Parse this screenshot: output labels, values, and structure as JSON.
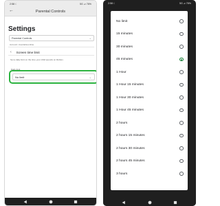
{
  "left": {
    "status": {
      "time": "2:58 ☾",
      "right": "5G ⊿ 76%"
    },
    "app_bar": {
      "title": "Parental Controls"
    },
    "settings_heading": "Settings",
    "select_value": "Parental Controls",
    "account": "Account: insertatisoonline",
    "subpage_title": "Screen time limit",
    "description": "Set a daily limit on the time your child spends on Roblox.",
    "field_label": "Daily limit",
    "field_value": "No limit"
  },
  "right": {
    "status": {
      "time": "2:58 ☾",
      "right": "5G ⊿ 76%"
    },
    "options": [
      "No limit",
      "15 minutes",
      "30 minutes",
      "45 minutes",
      "1 Hour",
      "1 Hour 15 minutes",
      "1 Hour 30 minutes",
      "1 Hour 45 minutes",
      "2 hours",
      "2 hours 15 minutes",
      "2 hours 30 minutes",
      "2 hours 45 minutes",
      "3 hours"
    ],
    "selected_index": 3
  },
  "colors": {
    "highlight": "#2bb33f",
    "radio_selected": "#188038"
  },
  "icons": {
    "back": "back-arrow-icon",
    "caret": "chevron-down-icon",
    "nav": [
      "back-triangle-icon",
      "home-circle-icon",
      "recents-square-icon"
    ]
  }
}
